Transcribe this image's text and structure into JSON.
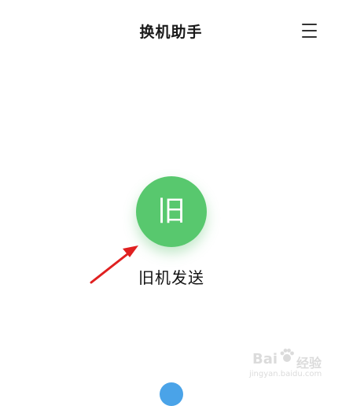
{
  "header": {
    "title": "换机助手",
    "menu_icon": "hamburger-menu-icon"
  },
  "main_action": {
    "icon_text": "旧",
    "label": "旧机发送",
    "color": "#58c86e"
  },
  "annotation": {
    "arrow_color": "#e02020"
  },
  "watermark": {
    "brand_text": "Bai",
    "brand_suffix": "经验",
    "url": "jingyan.baidu.com"
  },
  "bottom_hint": {
    "color": "#4aa3e8"
  }
}
